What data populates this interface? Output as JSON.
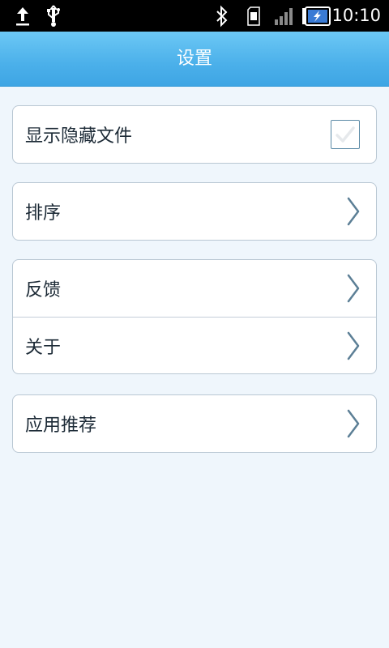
{
  "status_bar": {
    "time": "10:10",
    "icons": [
      "upload-icon",
      "usb-icon",
      "bluetooth-icon",
      "sd-card-icon",
      "signal-icon",
      "battery-charging-icon"
    ]
  },
  "header": {
    "title": "设置"
  },
  "settings": {
    "show_hidden_files": {
      "label": "显示隐藏文件",
      "checked": true
    },
    "sort": {
      "label": "排序"
    },
    "feedback": {
      "label": "反馈"
    },
    "about": {
      "label": "关于"
    },
    "app_recommend": {
      "label": "应用推荐"
    }
  },
  "colors": {
    "header_bg": "#4bb0ea",
    "page_bg": "#eff6fc",
    "chevron": "#5c7f96"
  }
}
